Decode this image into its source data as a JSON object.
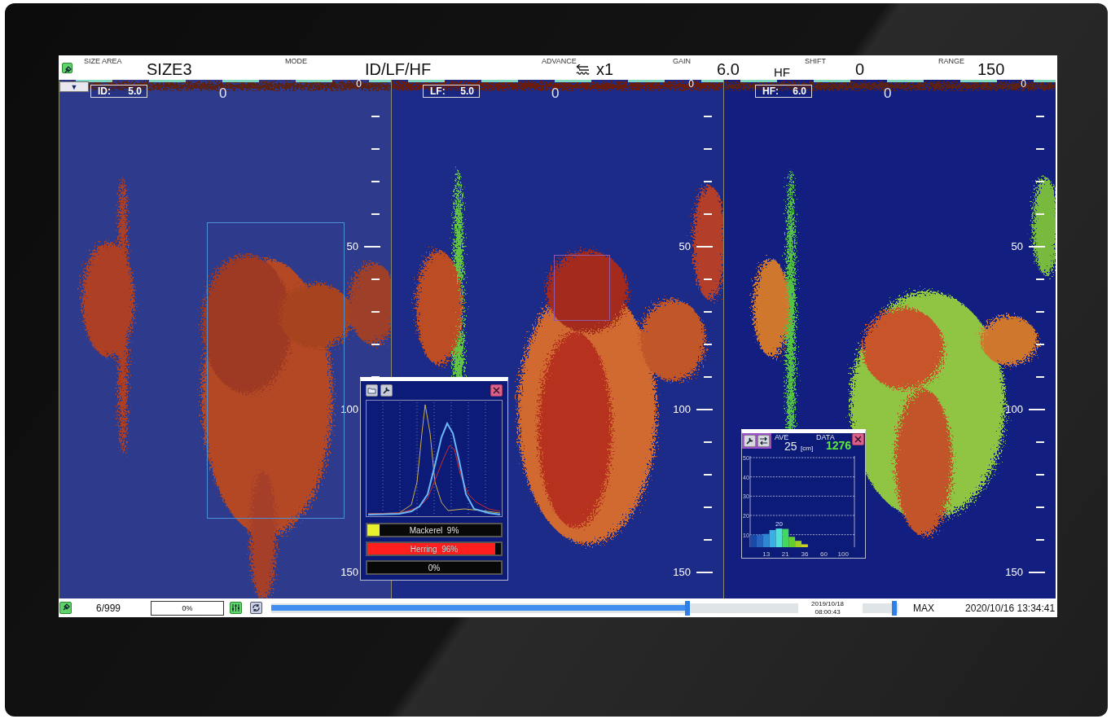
{
  "top_bar": {
    "items": [
      {
        "label": "SIZE AREA",
        "value": "SIZE3"
      },
      {
        "label": "MODE",
        "value": "ID/LF/HF"
      },
      {
        "label": "ADVANCE",
        "value": "x1"
      },
      {
        "label": "GAIN",
        "value": "6.0"
      },
      {
        "label": "SHIFT",
        "value": "0"
      },
      {
        "label": "RANGE",
        "value": "150"
      }
    ],
    "channel_tag": "HF"
  },
  "view_menu_button": "▼",
  "panels": [
    {
      "label": "ID:",
      "gain": "5.0",
      "center_marker": "0",
      "scale_zero": "0",
      "depth_labels": [
        "50",
        "100",
        "150"
      ],
      "selection": {
        "color": "#4c8fd6"
      }
    },
    {
      "label": "LF:",
      "gain": "5.0",
      "center_marker": "0",
      "scale_zero": "0",
      "depth_labels": [
        "50",
        "100",
        "150"
      ],
      "selection": {
        "color": "#8c5aa6"
      }
    },
    {
      "label": "HF:",
      "gain": "6.0",
      "center_marker": "0",
      "scale_zero": "0",
      "depth_labels": [
        "50",
        "100",
        "150"
      ]
    }
  ],
  "species_popup": {
    "bars": [
      {
        "label": "Mackerel  9%",
        "level": 0.09,
        "color": "#e8f22c"
      },
      {
        "label": "Herring  96%",
        "level": 0.96,
        "color": "#ff1f1f"
      },
      {
        "label": "0%",
        "level": 0
      }
    ]
  },
  "size_popup": {
    "ave_label": "AVE",
    "ave": "25",
    "unit": "[cm]",
    "data_label": "DATA",
    "data": "1276",
    "chart_data": {
      "type": "bar",
      "categories": [
        null,
        null,
        "13",
        null,
        null,
        "21",
        null,
        null,
        "36",
        null,
        null,
        "60",
        null,
        null,
        "100",
        null
      ],
      "values": [
        10,
        10,
        10.4,
        12.4,
        13.2,
        13,
        8.9,
        6.8,
        5,
        null,
        null,
        null,
        null,
        null,
        null,
        null
      ],
      "ylim": [
        3.5,
        50
      ],
      "yticks": [
        10,
        20,
        30,
        40,
        50
      ],
      "grid": true,
      "annotations": [
        {
          "y": 13.2,
          "text": "20"
        }
      ]
    }
  },
  "bottom_bar": {
    "counter": "6/999",
    "progress_field": "0%",
    "playback": {
      "level": 0.79
    },
    "record_date": "2019/10/18",
    "record_time": "08:00:43",
    "speed": {
      "level": 0.88
    },
    "speed_label": "MAX",
    "clock": "2020/10/16 13:34:41"
  }
}
